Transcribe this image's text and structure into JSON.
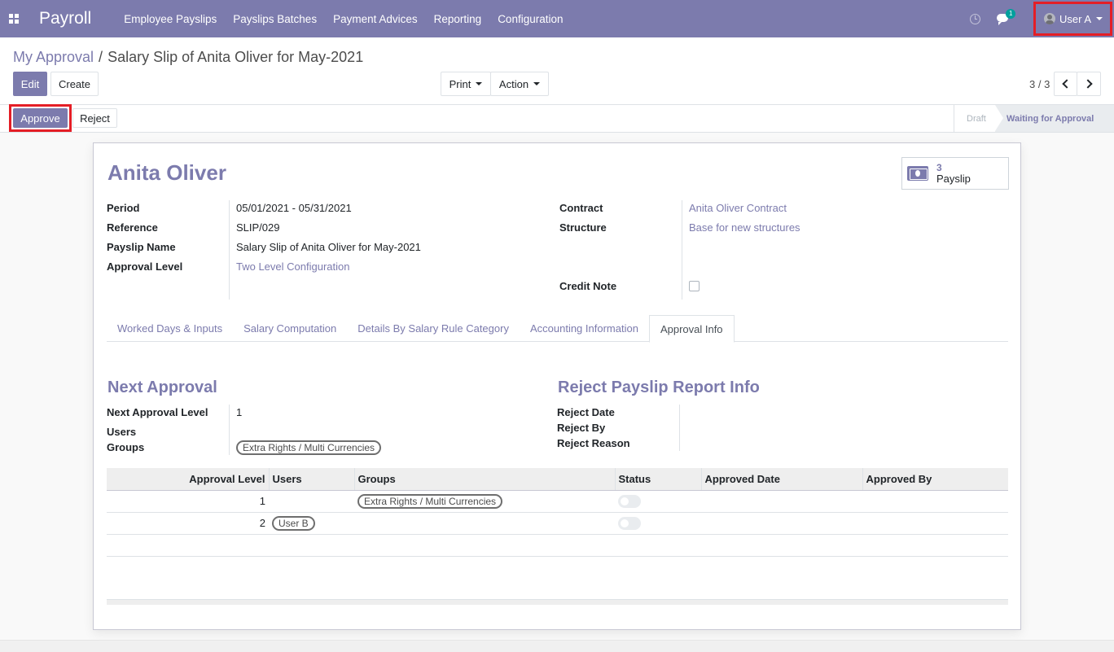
{
  "navbar": {
    "brand": "Payroll",
    "menu": [
      "Employee Payslips",
      "Payslips Batches",
      "Payment Advices",
      "Reporting",
      "Configuration"
    ],
    "chat_badge": "1",
    "user": "User A",
    "accent_color": "#7c7bad"
  },
  "control_panel": {
    "breadcrumb": {
      "parent": "My Approval",
      "separator": "/",
      "current": "Salary Slip of Anita Oliver for May-2021"
    },
    "edit_label": "Edit",
    "create_label": "Create",
    "print_label": "Print",
    "action_label": "Action",
    "pager": "3 / 3"
  },
  "statusbar": {
    "approve_label": "Approve",
    "reject_label": "Reject",
    "stages": [
      "Draft",
      "Waiting for Approval"
    ],
    "active_stage": "Waiting for Approval"
  },
  "form": {
    "title": "Anita Oliver",
    "smart_button": {
      "count": "3",
      "label": "Payslip"
    },
    "left_fields": [
      {
        "label": "Period",
        "value": "05/01/2021 - 05/31/2021"
      },
      {
        "label": "Reference",
        "value": "SLIP/029"
      },
      {
        "label": "Payslip Name",
        "value": "Salary Slip of Anita Oliver for May-2021"
      },
      {
        "label": "Approval Level",
        "value": "Two Level Configuration"
      }
    ],
    "right_fields": [
      {
        "label": "Contract",
        "value": "Anita Oliver Contract"
      },
      {
        "label": "Structure",
        "value": "Base for new structures"
      },
      {
        "label": "Credit Note",
        "value": ""
      }
    ],
    "credit_note_checked": false
  },
  "tabs": [
    "Worked Days & Inputs",
    "Salary Computation",
    "Details By Salary Rule Category",
    "Accounting Information",
    "Approval Info"
  ],
  "active_tab": "Approval Info",
  "next_approval": {
    "title": "Next Approval",
    "fields": [
      {
        "label": "Next Approval Level",
        "value": "1"
      },
      {
        "label": "Users",
        "value": ""
      },
      {
        "label": "Groups",
        "value": "Extra Rights / Multi Currencies"
      }
    ]
  },
  "reject_info": {
    "title": "Reject Payslip Report Info",
    "fields": [
      {
        "label": "Reject Date",
        "value": ""
      },
      {
        "label": "Reject By",
        "value": ""
      },
      {
        "label": "Reject Reason",
        "value": ""
      }
    ]
  },
  "approval_table": {
    "columns": [
      "Approval Level",
      "Users",
      "Groups",
      "Status",
      "Approved Date",
      "Approved By"
    ],
    "rows": [
      {
        "level": "1",
        "users": "",
        "groups": "Extra Rights / Multi Currencies",
        "status": false,
        "approved_date": "",
        "approved_by": ""
      },
      {
        "level": "2",
        "users": "User B",
        "groups": "",
        "status": false,
        "approved_date": "",
        "approved_by": ""
      }
    ]
  }
}
